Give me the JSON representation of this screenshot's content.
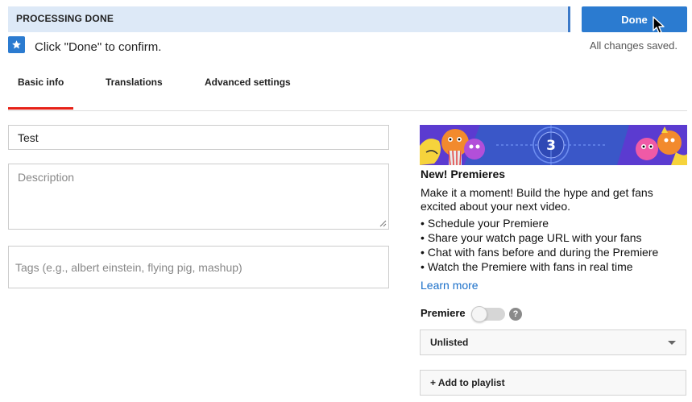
{
  "status_bar": {
    "text": "PROCESSING DONE",
    "done_label": "Done"
  },
  "notice": {
    "icon": "star-icon",
    "text": "Click \"Done\" to confirm.",
    "saved_text": "All changes saved."
  },
  "tabs": [
    {
      "label": "Basic info",
      "active": true
    },
    {
      "label": "Translations",
      "active": false
    },
    {
      "label": "Advanced settings",
      "active": false
    }
  ],
  "form": {
    "title_value": "Test",
    "description_placeholder": "Description",
    "tags_placeholder": "Tags (e.g., albert einstein, flying pig, mashup)"
  },
  "premieres": {
    "banner_number": "3",
    "title": "New! Premieres",
    "description": "Make it a moment! Build the hype and get fans excited about your next video.",
    "bullets": [
      "Schedule your Premiere",
      "Share your watch page URL with your fans",
      "Chat with fans before and during the Premiere",
      "Watch the Premiere with fans in real time"
    ],
    "learn_more": "Learn more",
    "toggle_label": "Premiere",
    "toggle_on": false,
    "help_icon": "question-icon"
  },
  "visibility": {
    "selected": "Unlisted"
  },
  "playlist": {
    "label": "+ Add to playlist"
  },
  "colors": {
    "accent": "#2b7bd0",
    "tab_active": "#e62117",
    "link": "#1a6fc9",
    "status_bg": "#dde9f7"
  }
}
